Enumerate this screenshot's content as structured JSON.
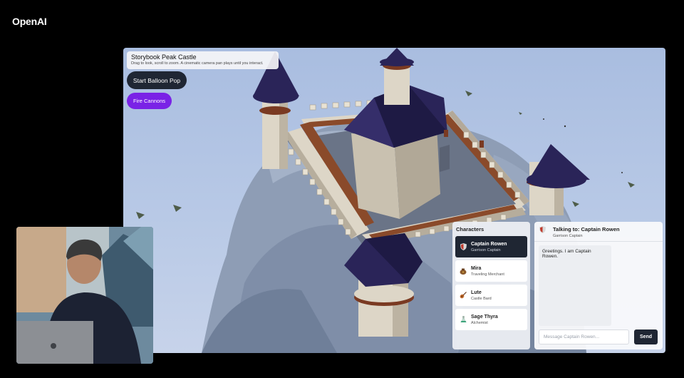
{
  "brand": {
    "name": "OpenAI"
  },
  "scene": {
    "title": "Storybook Peak Castle",
    "subtitle": "Drag to look, scroll to zoom. A cinematic camera pan plays until you interact.",
    "balloon_button": "Start Balloon Pop",
    "cannon_button": "Fire Cannons"
  },
  "characters": {
    "title": "Characters",
    "items": [
      {
        "name": "Captain Rowen",
        "role": "Garrison Captain",
        "icon": "shield-icon",
        "active": true
      },
      {
        "name": "Mira",
        "role": "Traveling Merchant",
        "icon": "pouch-icon",
        "active": false
      },
      {
        "name": "Lute",
        "role": "Castle Bard",
        "icon": "lute-icon",
        "active": false
      },
      {
        "name": "Sage Thyra",
        "role": "Alchemist",
        "icon": "flask-icon",
        "active": false
      }
    ]
  },
  "chat": {
    "title": "Talking to: Captain Rowen",
    "subtitle": "Garrison Captain",
    "icon": "shield-icon",
    "message": "Greetings. I am Captain Rowen.",
    "input_placeholder": "Message Captain Rowen...",
    "send_label": "Send"
  },
  "colors": {
    "background": "#000000",
    "sky": "#b4c5e4",
    "roof": "#2a2458",
    "wall": "#dcd4c4",
    "accent_purple": "#7a22e6",
    "dark_button": "#1f2633"
  }
}
